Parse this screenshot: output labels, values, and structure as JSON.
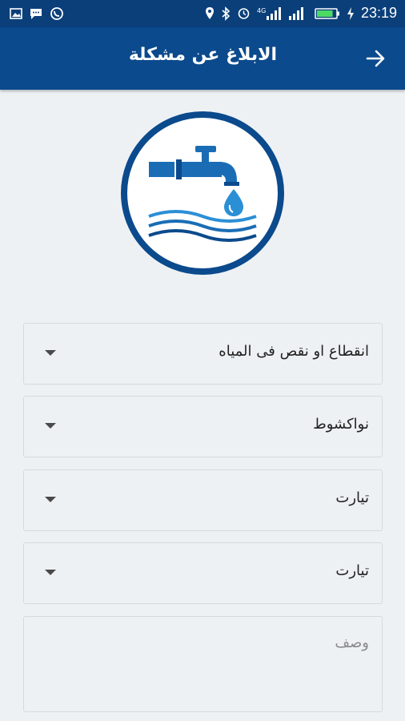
{
  "status_bar": {
    "time": "23:19",
    "network": "4G",
    "icons": [
      "image-icon",
      "chat-icon",
      "whatsapp-icon",
      "location-icon",
      "bluetooth-icon",
      "alarm-icon",
      "signal-icon",
      "signal-icon",
      "battery-icon",
      "charging-icon"
    ],
    "battery_level": 0.85
  },
  "header": {
    "title": "الابلاغ عن مشكلة",
    "back_icon": "arrow-right-icon"
  },
  "logo": {
    "icon": "water-tap-icon",
    "colors": {
      "ring": "#0b4a8c",
      "tap": "#1a6db5",
      "water": "#2b8fd6"
    }
  },
  "form": {
    "problem_type": "انقطاع او نقص فى المياه",
    "city": "نواكشوط",
    "district": "تيارت",
    "area": "تيارت",
    "description_placeholder": "وصف",
    "dropdown_icon": "dropdown-arrow-icon"
  },
  "colors": {
    "primary": "#0b4a8c",
    "status_bar": "#0b3f7a",
    "background": "#eef1f4"
  }
}
